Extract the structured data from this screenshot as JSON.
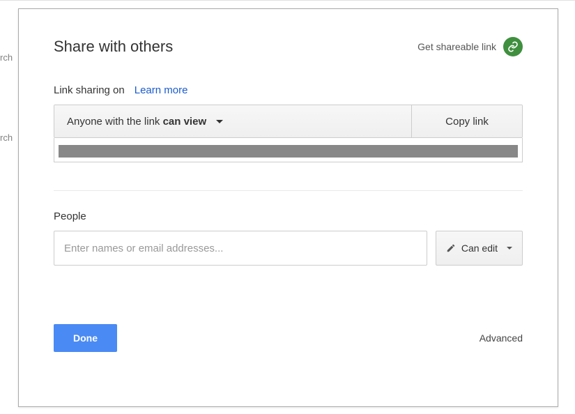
{
  "background": {
    "cell_fragment_1": "rch",
    "cell_fragment_2": "rch"
  },
  "dialog": {
    "title": "Share with others",
    "shareable_link_label": "Get shareable link",
    "link_sharing_label": "Link sharing on",
    "learn_more_label": "Learn more",
    "scope_prefix": "Anyone with the link ",
    "scope_permission": "can view",
    "copy_link_label": "Copy link",
    "people_label": "People",
    "people_placeholder": "Enter names or email addresses...",
    "can_edit_label": "Can edit",
    "done_label": "Done",
    "advanced_label": "Advanced"
  },
  "colors": {
    "link_icon_bg": "#3f8f3f",
    "done_btn_bg": "#4a8af4",
    "learn_more": "#1a5bce"
  }
}
